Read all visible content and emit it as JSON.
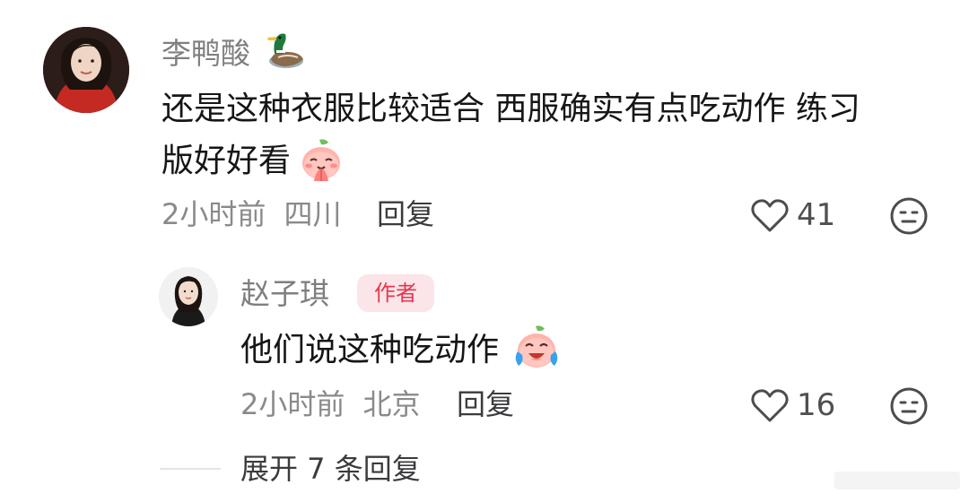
{
  "comment": {
    "username": "李鸭酸",
    "username_emoji": "duck-emoji",
    "text_line1": "还是这种衣服比较适合 西服确实有点吃动作 练习",
    "text_line2": "版好好看",
    "text_emoji": "peach-pray-emoji",
    "time": "2小时前",
    "location": "四川",
    "reply_label": "回复",
    "likes": "41"
  },
  "reply": {
    "username": "赵子琪",
    "badge": "作者",
    "text": "他们说这种吃动作",
    "text_emoji": "peach-crying-laughing-emoji",
    "time": "2小时前",
    "location": "北京",
    "reply_label": "回复",
    "likes": "16"
  },
  "expand": {
    "label": "展开 7 条回复"
  },
  "colors": {
    "badge_bg": "#fbe5e8",
    "badge_text": "#e8364f",
    "secondary_text": "#8a8a8c"
  }
}
